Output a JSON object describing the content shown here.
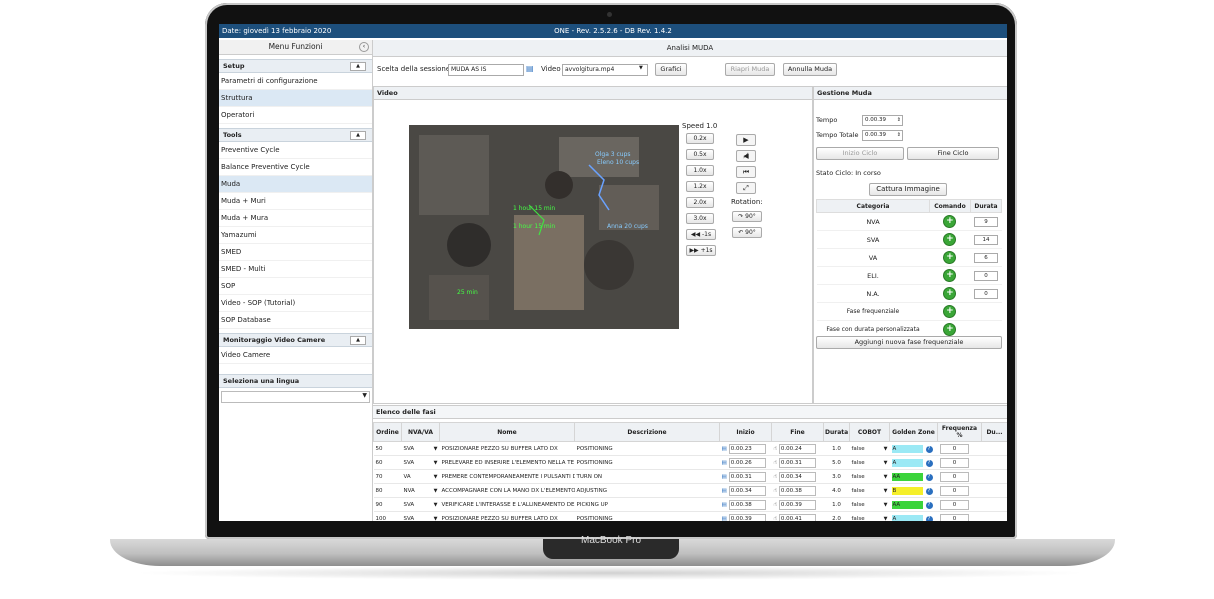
{
  "laptop": {
    "brand": "MacBook Pro"
  },
  "topbar": {
    "date": "Date: giovedì 13 febbraio 2020",
    "version": "ONE - Rev. 2.5.2.6 - DB Rev. 1.4.2"
  },
  "sidebar": {
    "title": "Menu Funzioni",
    "setup": {
      "label": "Setup",
      "items": [
        "Parametri di configurazione",
        "Struttura",
        "Operatori"
      ]
    },
    "tools": {
      "label": "Tools",
      "items": [
        "Preventive Cycle",
        "Balance Preventive Cycle",
        "Muda",
        "Muda + Muri",
        "Muda + Mura",
        "Yamazumi",
        "SMED",
        "SMED - Multi",
        "SOP",
        "Video - SOP (Tutorial)",
        "SOP Database"
      ]
    },
    "monitor": {
      "label": "Monitoraggio Video Camere",
      "items": [
        "Video Camere"
      ]
    },
    "lingua": {
      "label": "Seleziona una lingua"
    }
  },
  "main": {
    "title": "Analisi MUDA",
    "session_label": "Scelta della sessione",
    "session_value": "MUDA AS IS",
    "video_label": "Video",
    "video_value": "avvolgitura.mp4",
    "grafici": "Grafici",
    "riapri": "Riapri Muda",
    "annulla": "Annulla Muda"
  },
  "video_panel": {
    "title": "Video",
    "overlay": [
      "Olga 3 cups",
      "Eleno 10 cups",
      "1 hour 15 min",
      "1 hour 15 min",
      "Anna 20 cups",
      "25 min"
    ],
    "speed_title": "Speed 1.0",
    "speeds": [
      "0.2x",
      "0.5x",
      "1.0x",
      "1.2x",
      "2.0x",
      "3.0x"
    ],
    "skip_back": "◀◀ -1s",
    "skip_fwd": "▶▶ +1s",
    "rotation_label": "Rotation:",
    "rot_cw": "↷ 90°",
    "rot_ccw": "↶ 90°"
  },
  "muda_panel": {
    "title": "Gestione Muda",
    "tempo_label": "Tempo",
    "tempo_value": "0.00.39",
    "tempo_totale_label": "Tempo Totale",
    "tempo_totale_value": "0.00.39",
    "inizio": "Inizio Ciclo",
    "fine": "Fine Ciclo",
    "stato": "Stato Ciclo:  In corso",
    "cattura": "Cattura Immagine",
    "headers": [
      "Categoria",
      "Comando",
      "Durata"
    ],
    "rows": [
      {
        "cat": "NVA",
        "dur": "9"
      },
      {
        "cat": "SVA",
        "dur": "14"
      },
      {
        "cat": "VA",
        "dur": "6"
      },
      {
        "cat": "ELI.",
        "dur": "0"
      },
      {
        "cat": "N.A.",
        "dur": "0"
      }
    ],
    "fase_freq": "Fase frequenziale",
    "fase_durata": "Fase con durata personalizzata",
    "aggiungi": "Aggiungi nuova fase frequenziale"
  },
  "fasi": {
    "title": "Elenco delle fasi",
    "headers": [
      "Ordine",
      "NVA/VA",
      "Nome",
      "Descrizione",
      "Inizio",
      "Fine",
      "Durata",
      "COBOT",
      "Golden Zone",
      "Frequenza %",
      "Du..."
    ],
    "rows": [
      {
        "ord": "50",
        "nva": "SVA",
        "nome": "POSIZIONARE PEZZO SU BUFFER LATO DX",
        "desc": "POSITIONING",
        "ini": "0.00.23",
        "fin": "0.00.24",
        "dur": "1.0",
        "cobot": "false",
        "gz": "A",
        "gzc": "#9be9f5",
        "freq": "0"
      },
      {
        "ord": "60",
        "nva": "SVA",
        "nome": "PRELEVARE ED INSERIRE L'ELEMENTO NELLA TE",
        "desc": "POSITIONING",
        "ini": "0.00.26",
        "fin": "0.00.31",
        "dur": "5.0",
        "cobot": "false",
        "gz": "A",
        "gzc": "#9be9f5",
        "freq": "0"
      },
      {
        "ord": "70",
        "nva": "VA",
        "nome": "PREMERE CONTEMPORANEAMENTE I PULSANTI D",
        "desc": "TURN ON",
        "ini": "0.00.31",
        "fin": "0.00.34",
        "dur": "3.0",
        "cobot": "false",
        "gz": "AA",
        "gzc": "#3bd43b",
        "freq": "0"
      },
      {
        "ord": "80",
        "nva": "NVA",
        "nome": "ACCOMPAGNARE CON LA MANO DX L'ELEMENTO",
        "desc": "ADJUSTING",
        "ini": "0.00.34",
        "fin": "0.00.38",
        "dur": "4.0",
        "cobot": "false",
        "gz": "B",
        "gzc": "#f5ef2a",
        "freq": "0"
      },
      {
        "ord": "90",
        "nva": "SVA",
        "nome": "VERIFICARE L'INTERASSE E L'ALLINEAMENTO DE",
        "desc": "PICKING UP",
        "ini": "0.00.38",
        "fin": "0.00.39",
        "dur": "1.0",
        "cobot": "false",
        "gz": "AA",
        "gzc": "#3bd43b",
        "freq": "0"
      },
      {
        "ord": "100",
        "nva": "SVA",
        "nome": "POSIZIONARE PEZZO SU BUFFER LATO DX",
        "desc": "POSITIONING",
        "ini": "0.00.39",
        "fin": "0.00.41",
        "dur": "2.0",
        "cobot": "false",
        "gz": "A",
        "gzc": "#9be9f5",
        "freq": "0"
      }
    ]
  }
}
